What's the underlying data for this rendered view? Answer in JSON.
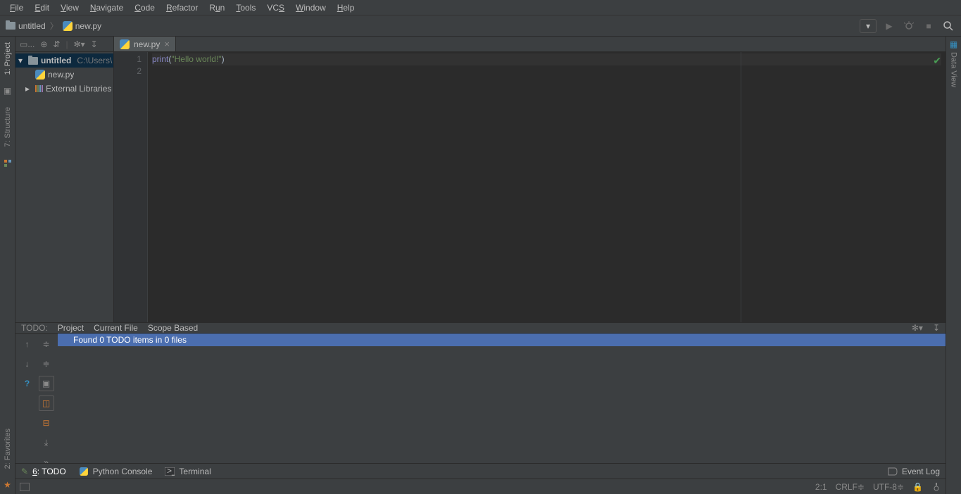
{
  "menu": {
    "file": "File",
    "edit": "Edit",
    "view": "View",
    "navigate": "Navigate",
    "code": "Code",
    "refactor": "Refactor",
    "run": "Run",
    "tools": "Tools",
    "vcs": "VCS",
    "window": "Window",
    "help": "Help"
  },
  "breadcrumb": {
    "project": "untitled",
    "file": "new.py"
  },
  "toolbar_right": {
    "config_dropdown": "",
    "run": "▶",
    "debug": "",
    "stop": "■",
    "search": ""
  },
  "left_sidebar": {
    "project": "1: Project",
    "structure": "7: Structure",
    "favorites": "2: Favorites"
  },
  "right_sidebar": {
    "dataview": "Data View"
  },
  "project_tree": {
    "root": {
      "name": "untitled",
      "path": "C:\\Users\\"
    },
    "file": "new.py",
    "external": "External Libraries"
  },
  "editor": {
    "tab": "new.py",
    "lines": [
      "1",
      "2"
    ],
    "code": {
      "fn": "print",
      "open": "(",
      "str": "\"Hello world!\"",
      "close": ")"
    }
  },
  "todo": {
    "label": "TODO:",
    "tabs": {
      "project": "Project",
      "current": "Current File",
      "scope": "Scope Based"
    },
    "message": "Found 0 TODO items in 0 files"
  },
  "bottom": {
    "todo": "6: TODO",
    "todo_ul": "6",
    "todo_rest": ": TODO",
    "pyconsole": "Python Console",
    "terminal": "Terminal",
    "eventlog": "Event Log"
  },
  "status": {
    "pos": "2:1",
    "eol": "CRLF",
    "enc": "UTF-8",
    "lock": "",
    "inspect": ""
  }
}
